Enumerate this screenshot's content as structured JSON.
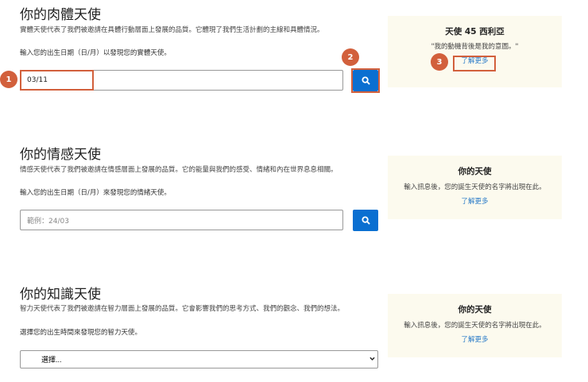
{
  "physical": {
    "title": "你的肉體天使",
    "desc": "實體天使代表了我們被邀請在具體行動層面上發展的品質。它體現了我們生活計劃的主線和具體情況。",
    "prompt": "輸入您的出生日期（日/月）以發現您的實體天使。",
    "value": "03/11"
  },
  "physical_card": {
    "title": "天使 45 西利亞",
    "quote": "\"我的動機背後是我的意圖。\"",
    "link": "了解更多"
  },
  "emotional": {
    "title": "你的情感天使",
    "desc": "情感天使代表了我們被邀請在情感層面上發展的品質。它的能量與我們的感受、情緒和內在世界息息相關。",
    "prompt": "輸入您的出生日期（日/月）來發現您的情緒天使。",
    "placeholder": "範例：24/03"
  },
  "emotional_card": {
    "title": "你的天使",
    "text": "輸入訊息後，您的誕生天使的名字將出現在此。",
    "link": "了解更多"
  },
  "intellectual": {
    "title": "你的知識天使",
    "desc": "智力天使代表了我們被邀請在智力層面上發展的品質。它會影響我們的思考方式、我們的觀念、我們的想法。",
    "prompt": "選擇您的出生時間來發現您的智力天使。",
    "select": "選擇..."
  },
  "intellectual_card": {
    "title": "你的天使",
    "text": "輸入訊息後，您的誕生天使的名字將出現在此。",
    "link": "了解更多"
  },
  "annotations": [
    "1",
    "2",
    "3"
  ],
  "colors": {
    "accent": "#0a6fd1",
    "annotation": "#d2603c",
    "card": "#fcfaee"
  }
}
